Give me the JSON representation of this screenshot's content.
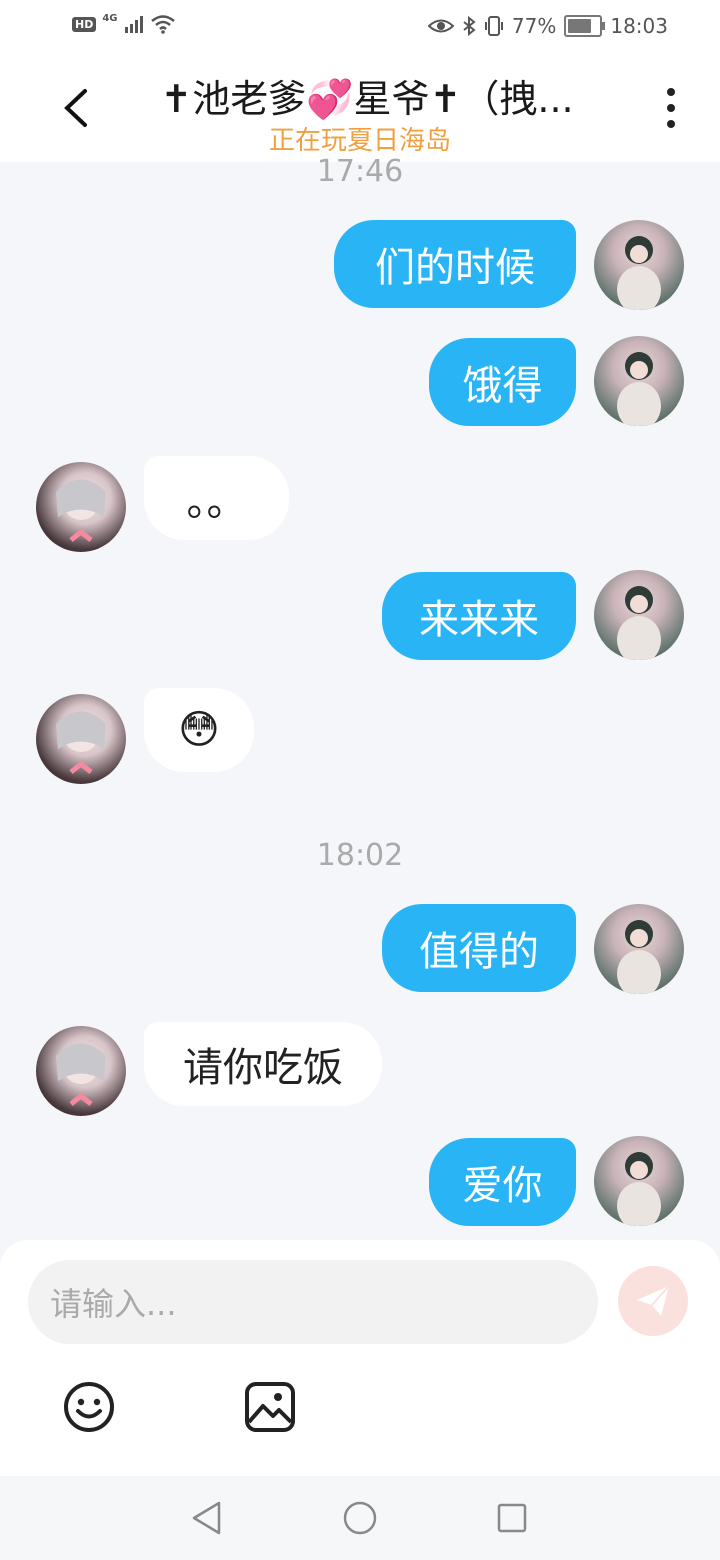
{
  "status_bar": {
    "hd": "HD",
    "network": "4G",
    "battery_percent": "77%",
    "battery_level": 0.77,
    "time": "18:03"
  },
  "header": {
    "title": "✝池老爹💞星爷✝（拽...",
    "subtitle": "正在玩夏日海岛",
    "back_icon": "chevron-left-icon",
    "more_icon": "more-vertical-icon"
  },
  "chat": {
    "timestamps": [
      "17:46",
      "18:02"
    ],
    "messages": [
      {
        "side": "right",
        "text": "们的时候"
      },
      {
        "side": "right",
        "text": "饿得"
      },
      {
        "side": "left",
        "text": "。。"
      },
      {
        "side": "right",
        "text": "来来来"
      },
      {
        "side": "left",
        "text": "😳"
      },
      {
        "side": "right",
        "text": "值得的"
      },
      {
        "side": "left",
        "text": "请你吃饭"
      },
      {
        "side": "right",
        "text": "爱你"
      }
    ]
  },
  "composer": {
    "placeholder": "请输入...",
    "send_icon": "send-icon",
    "emoji_icon": "smiley-icon",
    "image_icon": "image-icon"
  },
  "nav_bar": {
    "back_icon": "triangle-back-icon",
    "home_icon": "circle-home-icon",
    "recents_icon": "square-recents-icon"
  },
  "colors": {
    "bubble_outgoing": "#28b4f5",
    "bubble_incoming": "#ffffff",
    "subtitle": "#f0a040",
    "send_button": "#fbe1dd"
  }
}
